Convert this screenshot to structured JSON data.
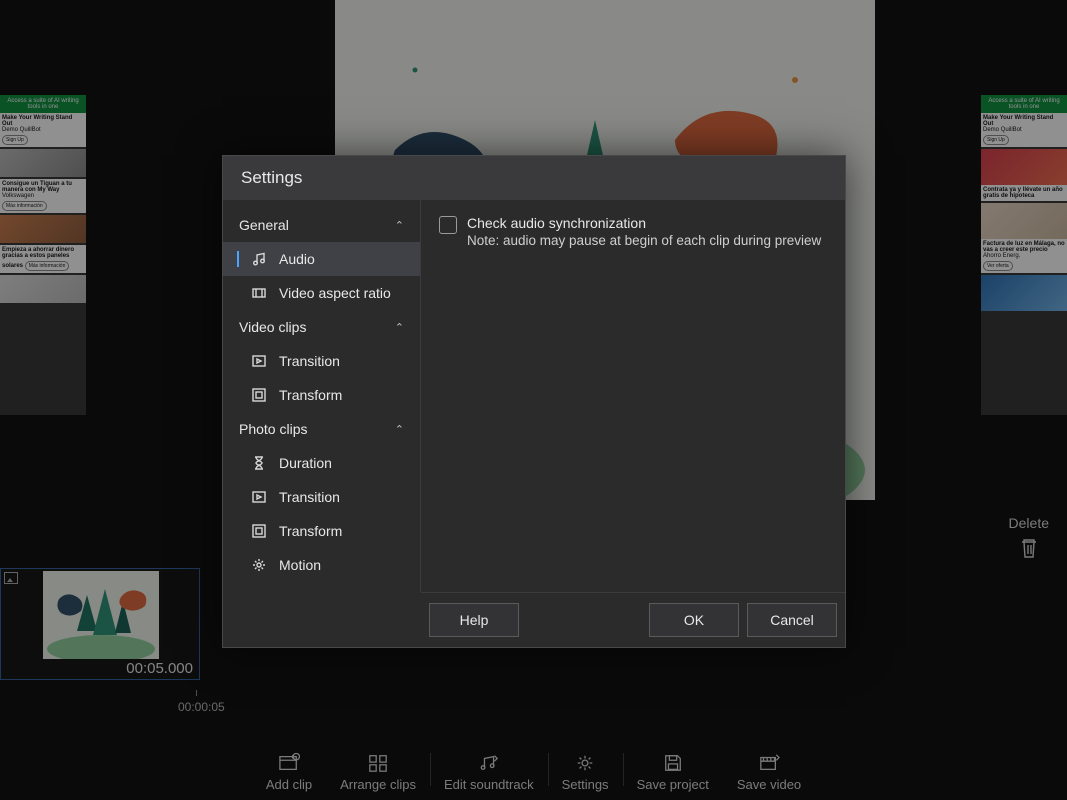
{
  "preview": {},
  "ads_left": {
    "headline": "Access a suite of AI writing tools in one",
    "items": [
      {
        "title": "Make Your Writing Stand Out",
        "sub": "Demo QuillBot",
        "cta": "Sign Up"
      },
      {
        "title": "Consigue un Tiguan a tu manera con My Way",
        "sub": "Volkswagen",
        "cta": "Más información"
      },
      {
        "title": "Empieza a ahorrar dinero gracias a estos paneles solares",
        "sub": "",
        "cta": "Más información"
      }
    ]
  },
  "ads_right": {
    "headline": "Access a suite of AI writing tools in one",
    "items": [
      {
        "title": "Make Your Writing Stand Out",
        "sub": "Demo QuillBot",
        "cta": "Sign Up"
      },
      {
        "title": "Contrata ya y llévate un año gratis de hipoteca",
        "sub": "",
        "cta": ""
      },
      {
        "title": "Factura de luz en Málaga, no vas a creer este precio",
        "sub": "Ahorro Energ.",
        "cta": "Ver oferta"
      }
    ]
  },
  "delete": {
    "label": "Delete"
  },
  "timeline": {
    "clip_time": "00:05.000",
    "ruler_label": "00:00:05"
  },
  "bottom_bar": {
    "items": [
      {
        "label": "Add clip"
      },
      {
        "label": "Arrange clips"
      },
      {
        "label": "Edit soundtrack"
      },
      {
        "label": "Settings"
      },
      {
        "label": "Save project"
      },
      {
        "label": "Save video"
      }
    ]
  },
  "dialog": {
    "title": "Settings",
    "sidebar": {
      "general": {
        "label": "General",
        "items": [
          {
            "label": "Audio",
            "selected": true
          },
          {
            "label": "Video aspect ratio",
            "selected": false
          }
        ]
      },
      "video_clips": {
        "label": "Video clips",
        "items": [
          {
            "label": "Transition"
          },
          {
            "label": "Transform"
          }
        ]
      },
      "photo_clips": {
        "label": "Photo clips",
        "items": [
          {
            "label": "Duration"
          },
          {
            "label": "Transition"
          },
          {
            "label": "Transform"
          },
          {
            "label": "Motion"
          }
        ]
      }
    },
    "content": {
      "check_label": "Check audio synchronization",
      "check_note": "Note: audio may pause at begin of each clip during preview"
    },
    "buttons": {
      "help": "Help",
      "ok": "OK",
      "cancel": "Cancel"
    }
  }
}
